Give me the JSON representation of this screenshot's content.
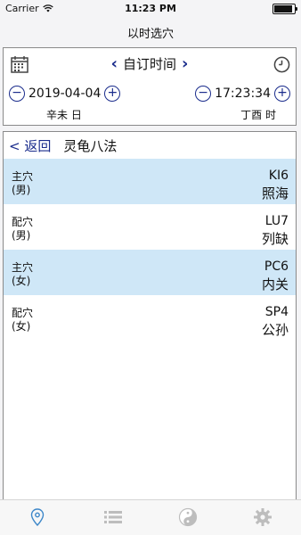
{
  "status": {
    "carrier": "Carrier",
    "time": "11:23 PM",
    "battery_level": 1.0
  },
  "nav": {
    "title": "以时选穴"
  },
  "panel": {
    "mode_label": "自订时间",
    "date": "2019-04-04",
    "time": "17:23:34",
    "day_ganzhi": "辛未 日",
    "hour_ganzhi": "丁酉 时",
    "minus": "−",
    "plus": "+"
  },
  "results": {
    "back_label": "< 返回",
    "method_title": "灵龟八法",
    "items": [
      {
        "role": "主穴\n(男)",
        "code": "KI6",
        "name": "照海",
        "highlight": true
      },
      {
        "role": "配穴\n(男)",
        "code": "LU7",
        "name": "列缺",
        "highlight": false
      },
      {
        "role": "主穴\n(女)",
        "code": "PC6",
        "name": "内关",
        "highlight": true
      },
      {
        "role": "配穴\n(女)",
        "code": "SP4",
        "name": "公孙",
        "highlight": false
      }
    ]
  },
  "tabs": [
    {
      "icon": "location-pin-icon",
      "active": true,
      "color": "#3d87c9"
    },
    {
      "icon": "list-icon",
      "active": false,
      "color": "#bdbdbd"
    },
    {
      "icon": "yin-yang-icon",
      "active": false,
      "color": "#bdbdbd"
    },
    {
      "icon": "gear-icon",
      "active": false,
      "color": "#bdbdbd"
    }
  ]
}
